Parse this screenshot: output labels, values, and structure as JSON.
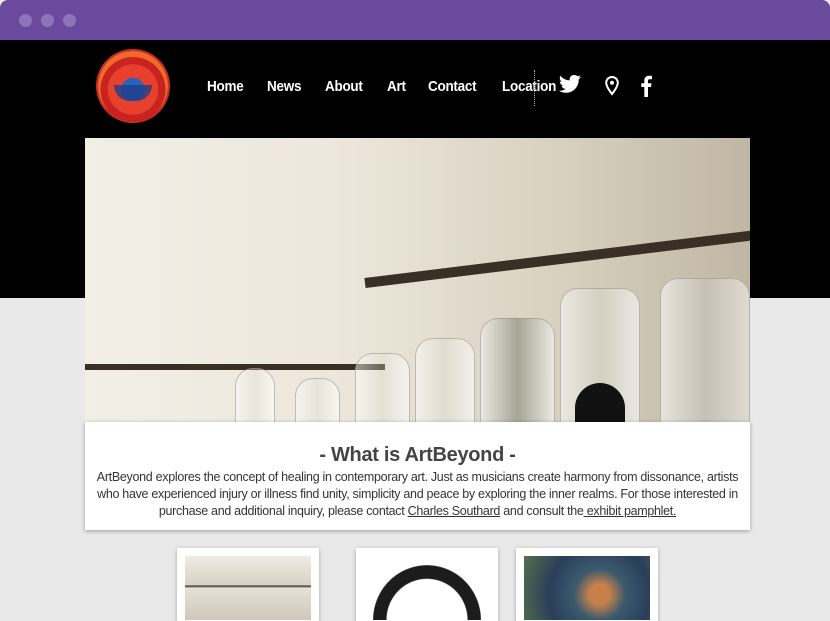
{
  "window": {
    "controls": [
      "close",
      "minimize",
      "maximize"
    ]
  },
  "nav": {
    "items": [
      "Home",
      "News",
      "About",
      "Art",
      "Contact",
      "Location"
    ]
  },
  "social": {
    "icons": [
      "twitter-icon",
      "location-pin-icon",
      "facebook-icon"
    ]
  },
  "content": {
    "heading": "- What is ArtBeyond -",
    "body_1": "ArtBeyond explores the concept of healing in contemporary art. Just as musicians create harmony from dissonance, artists who have experienced injury or illness find unity, simplicity and peace by exploring the inner realms.  For those interested in purchase and additional inquiry, please contact ",
    "link_contact": "Charles Southard",
    "body_2": " and consult the",
    "link_pamphlet": " exhibit pamphlet."
  },
  "colors": {
    "titlebar": "#6a4a9c",
    "header": "#000000",
    "page": "#e9e9ea"
  }
}
